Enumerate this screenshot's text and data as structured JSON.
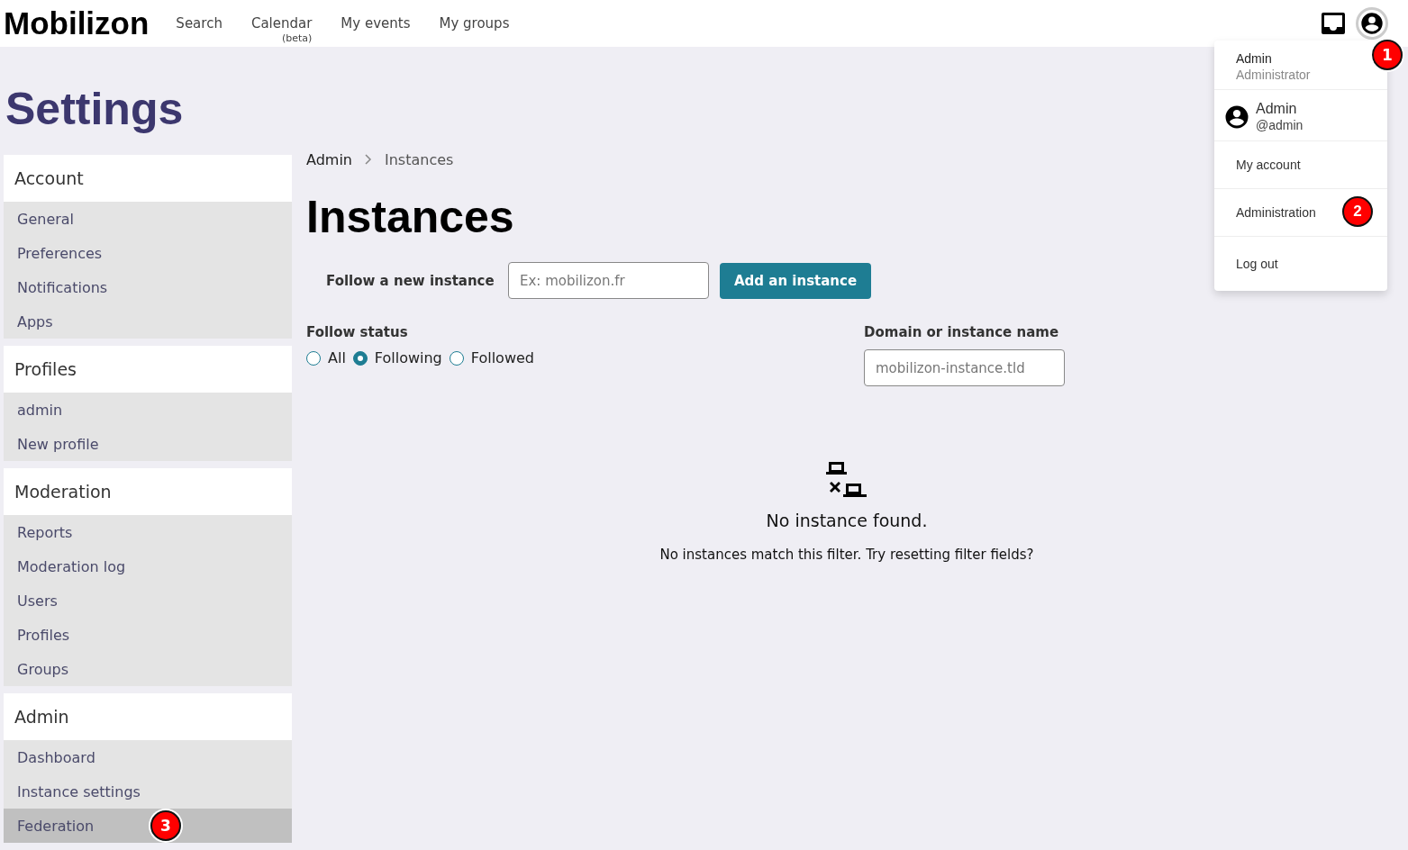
{
  "header": {
    "logo": "Mobilizon",
    "nav": [
      {
        "label": "Search"
      },
      {
        "label": "Calendar",
        "sub": "(beta)"
      },
      {
        "label": "My events"
      },
      {
        "label": "My groups"
      }
    ],
    "user_badge": "1"
  },
  "user_menu": {
    "name": "Admin",
    "role": "Administrator",
    "profile": {
      "name": "Admin",
      "handle": "@admin"
    },
    "items": [
      {
        "label": "My account"
      },
      {
        "label": "Administration",
        "badge": "2"
      },
      {
        "label": "Log out"
      }
    ]
  },
  "page_title": "Settings",
  "sidebar": {
    "sections": [
      {
        "title": "Account",
        "items": [
          {
            "label": "General",
            "selected": false
          },
          {
            "label": "Preferences",
            "selected": false
          },
          {
            "label": "Notifications",
            "selected": false
          },
          {
            "label": "Apps",
            "selected": false
          }
        ]
      },
      {
        "title": "Profiles",
        "items": [
          {
            "label": "admin",
            "selected": false
          },
          {
            "label": "New profile",
            "selected": false
          }
        ]
      },
      {
        "title": "Moderation",
        "items": [
          {
            "label": "Reports",
            "selected": false
          },
          {
            "label": "Moderation log",
            "selected": false
          },
          {
            "label": "Users",
            "selected": false
          },
          {
            "label": "Profiles",
            "selected": false
          },
          {
            "label": "Groups",
            "selected": false
          }
        ]
      },
      {
        "title": "Admin",
        "items": [
          {
            "label": "Dashboard",
            "selected": false
          },
          {
            "label": "Instance settings",
            "selected": false
          },
          {
            "label": "Federation",
            "selected": true,
            "badge": "3"
          }
        ]
      }
    ]
  },
  "breadcrumb": [
    "Admin",
    "Instances"
  ],
  "heading": "Instances",
  "follow_form": {
    "label": "Follow a new instance",
    "placeholder": "Ex: mobilizon.fr",
    "button": "Add an instance"
  },
  "filters": {
    "status_label": "Follow status",
    "options": [
      {
        "label": "All",
        "selected": false
      },
      {
        "label": "Following",
        "selected": true
      },
      {
        "label": "Followed",
        "selected": false
      }
    ],
    "domain_label": "Domain or instance name",
    "domain_placeholder": "mobilizon-instance.tld"
  },
  "empty_state": {
    "title": "No instance found.",
    "message": "No instances match this filter. Try resetting filter fields?"
  }
}
